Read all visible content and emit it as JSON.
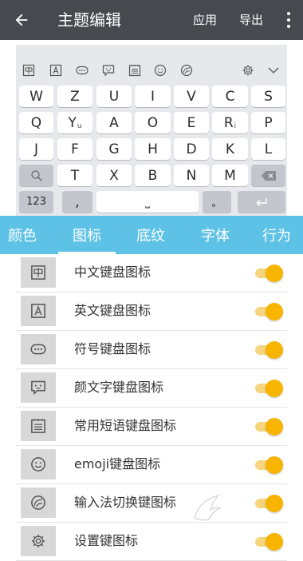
{
  "appbar": {
    "title": "主题编辑",
    "apply_label": "应用",
    "export_label": "导出",
    "back_icon": "arrow-left-icon",
    "more_icon": "more-vertical-icon",
    "background": "#46494e"
  },
  "keyboard": {
    "toolbar_icons": [
      "chinese-keyboard-icon",
      "english-keyboard-icon",
      "symbol-keyboard-icon",
      "emoticon-keyboard-icon",
      "phrase-keyboard-icon",
      "emoji-icon",
      "switch-input-icon",
      "settings-icon",
      "chevron-down-icon"
    ],
    "row1": [
      "W",
      "Z",
      "U",
      "I",
      "V",
      "C",
      "S"
    ],
    "row2": [
      "Q",
      "Y",
      "A",
      "O",
      "E",
      "R",
      "P"
    ],
    "row2_subs": {
      "Y": "u",
      "R": "i"
    },
    "row3": [
      "J",
      "F",
      "G",
      "H",
      "D",
      "K",
      "L"
    ],
    "row4": [
      "T",
      "X",
      "B",
      "N",
      "M"
    ],
    "num_label": "123",
    "comma_label": ",",
    "space_label": "⎵",
    "period_label": "。",
    "enter_icon": "enter-icon",
    "search_icon": "search-icon",
    "delete_icon": "backspace-icon"
  },
  "tabs": {
    "items": [
      "颜色",
      "图标",
      "底纹",
      "字体",
      "行为"
    ],
    "active": "图标",
    "background": "#5ec2e6"
  },
  "list": {
    "items": [
      {
        "label": "中文键盘图标",
        "icon": "chinese-keyboard-icon",
        "on": true
      },
      {
        "label": "英文键盘图标",
        "icon": "english-keyboard-icon",
        "on": true
      },
      {
        "label": "符号键盘图标",
        "icon": "symbol-keyboard-icon",
        "on": true
      },
      {
        "label": "颜文字键盘图标",
        "icon": "emoticon-keyboard-icon",
        "on": true
      },
      {
        "label": "常用短语键盘图标",
        "icon": "phrase-keyboard-icon",
        "on": true
      },
      {
        "label": "emoji键盘图标",
        "icon": "emoji-icon",
        "on": true
      },
      {
        "label": "输入法切换键图标",
        "icon": "switch-input-icon",
        "on": true
      },
      {
        "label": "设置键图标",
        "icon": "settings-icon",
        "on": true
      }
    ],
    "toggle_color": "#f7b500"
  }
}
